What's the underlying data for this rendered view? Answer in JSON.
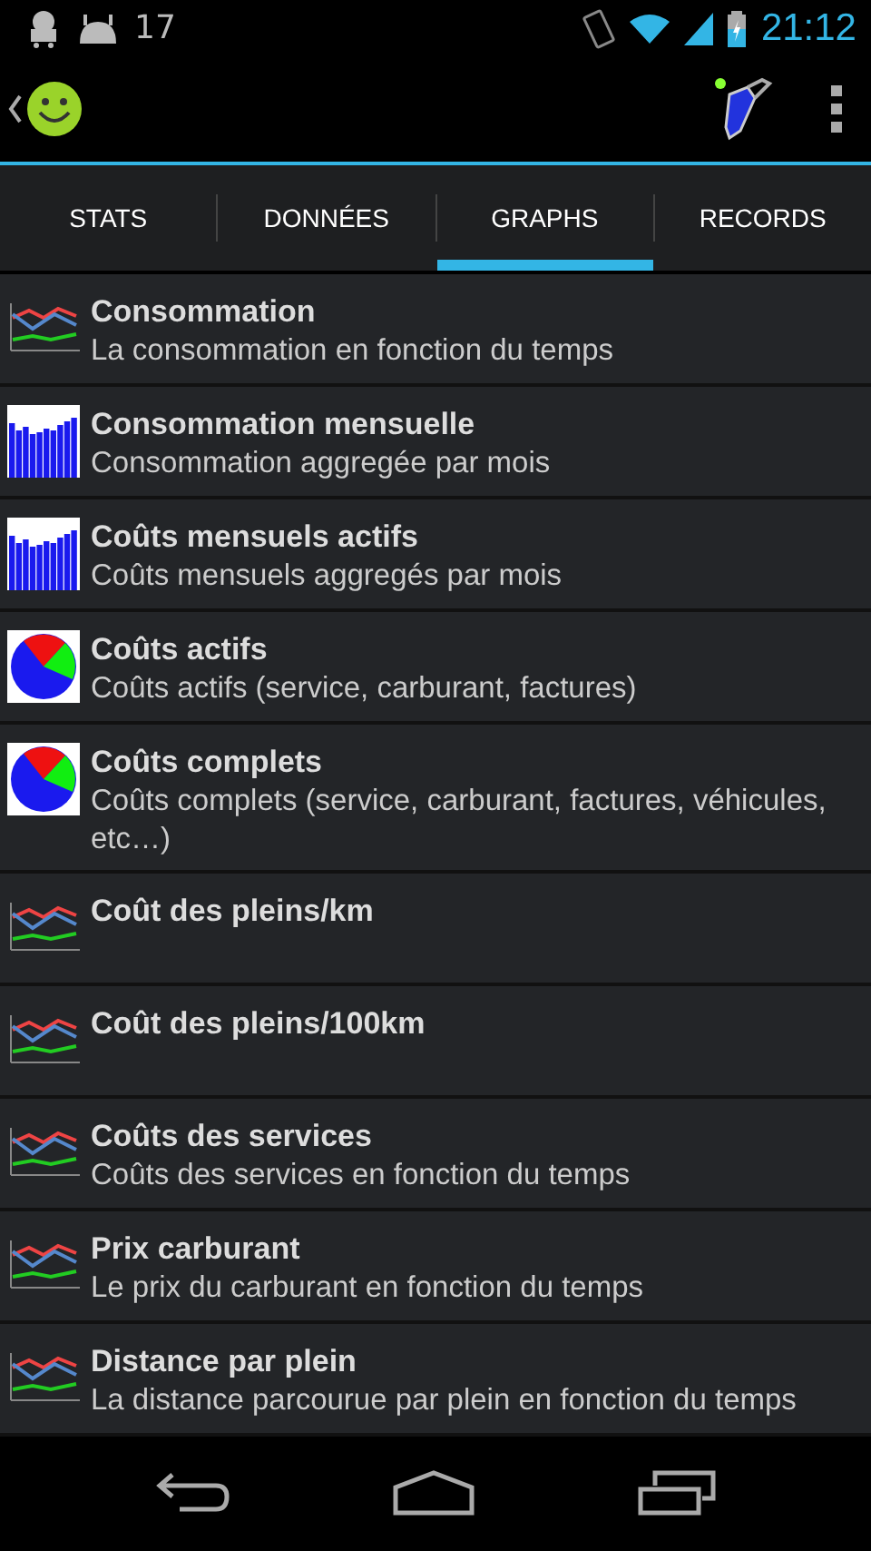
{
  "status_bar": {
    "notification_number": "17",
    "time": "21:12"
  },
  "tabs": [
    {
      "label": "STATS",
      "selected": false
    },
    {
      "label": "DONNÉES",
      "selected": false
    },
    {
      "label": "GRAPHS",
      "selected": true
    },
    {
      "label": "RECORDS",
      "selected": false
    }
  ],
  "graphs": [
    {
      "kind": "line",
      "title": "Consommation",
      "subtitle": "La consommation en fonction du temps"
    },
    {
      "kind": "bar",
      "title": "Consommation mensuelle",
      "subtitle": "Consommation aggregée par mois"
    },
    {
      "kind": "bar",
      "title": "Coûts mensuels actifs",
      "subtitle": "Coûts mensuels aggregés par mois"
    },
    {
      "kind": "pie",
      "title": "Coûts actifs",
      "subtitle": "Coûts actifs (service, carburant, factures)"
    },
    {
      "kind": "pie",
      "title": "Coûts complets",
      "subtitle": "Coûts complets (service, carburant, factures, véhicules, etc…)"
    },
    {
      "kind": "line",
      "title": "Coût des pleins/km"
    },
    {
      "kind": "line",
      "title": "Coût des pleins/100km"
    },
    {
      "kind": "line",
      "title": "Coûts des services",
      "subtitle": "Coûts des services en fonction du temps"
    },
    {
      "kind": "line",
      "title": "Prix carburant",
      "subtitle": "Le prix du carburant en fonction du temps"
    },
    {
      "kind": "line",
      "title": "Distance par plein",
      "subtitle": "La distance parcourue par plein en fonction du temps"
    }
  ]
}
